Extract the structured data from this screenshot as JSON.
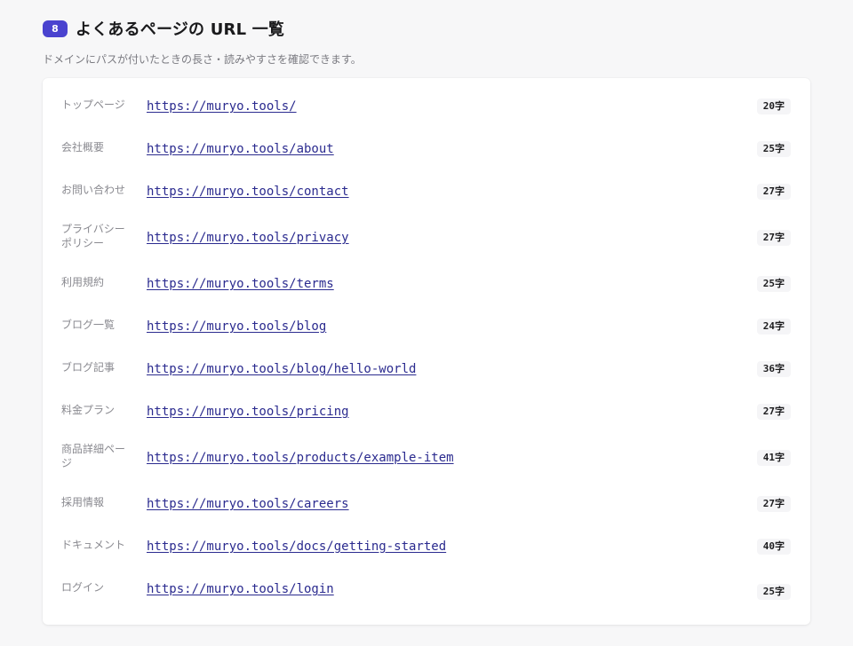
{
  "section": {
    "number": "8",
    "title": "よくあるページの URL 一覧",
    "description": "ドメインにパスが付いたときの長さ・読みやすさを確認できます。"
  },
  "rows": [
    {
      "label": "トップページ",
      "url": "https://muryo.tools/",
      "count": "20字"
    },
    {
      "label": "会社概要",
      "url": "https://muryo.tools/about",
      "count": "25字"
    },
    {
      "label": "お問い合わせ",
      "url": "https://muryo.tools/contact",
      "count": "27字"
    },
    {
      "label": "プライバシーポリシー",
      "url": "https://muryo.tools/privacy",
      "count": "27字"
    },
    {
      "label": "利用規約",
      "url": "https://muryo.tools/terms",
      "count": "25字"
    },
    {
      "label": "ブログ一覧",
      "url": "https://muryo.tools/blog",
      "count": "24字"
    },
    {
      "label": "ブログ記事",
      "url": "https://muryo.tools/blog/hello-world",
      "count": "36字"
    },
    {
      "label": "料金プラン",
      "url": "https://muryo.tools/pricing",
      "count": "27字"
    },
    {
      "label": "商品詳細ページ",
      "url": "https://muryo.tools/products/example-item",
      "count": "41字"
    },
    {
      "label": "採用情報",
      "url": "https://muryo.tools/careers",
      "count": "27字"
    },
    {
      "label": "ドキュメント",
      "url": "https://muryo.tools/docs/getting-started",
      "count": "40字"
    },
    {
      "label": "ログイン",
      "url": "https://muryo.tools/login",
      "count": "25字"
    }
  ],
  "colors": {
    "accent": "#4a43cf",
    "link": "#2b2b8f",
    "muted_text": "#8a8a90",
    "page_background": "#f7f7f8",
    "card_background": "#ffffff",
    "count_badge_background": "#f5f5f7"
  }
}
